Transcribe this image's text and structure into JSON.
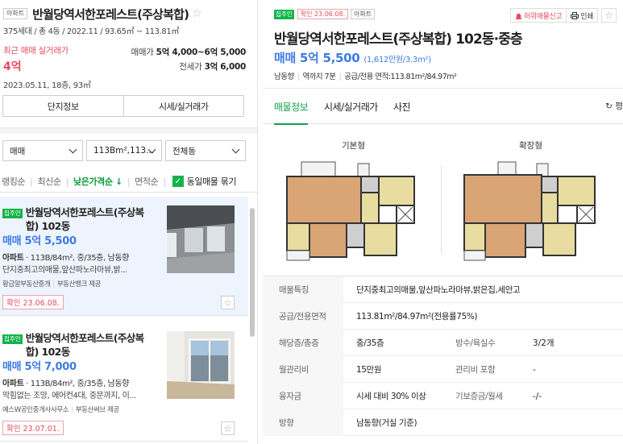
{
  "left": {
    "header": {
      "type_tag": "아파트",
      "title": "반월당역서한포레스트(주상복합)",
      "subtitle": "375세대 / 총 4동 / 2022.11 / 93.65㎡ ~ 113.81㎡",
      "recent_label": "최근 매매 실거래가",
      "recent_value": "4억",
      "recent_date": "2023.05.11, 18층, 93㎡",
      "sale_label": "매매가",
      "sale_range": "5억 4,000~6억 5,000",
      "rent_label": "전세가",
      "rent_range": "3억 6,000"
    },
    "buttons": {
      "complex_info": "단지정보",
      "market_price": "시세/실거래가"
    },
    "filters": {
      "trade_type": "매매",
      "area": "113Bm²,113...",
      "building": "전체동"
    },
    "sort": {
      "options": [
        "랭킹순",
        "최신순",
        "낮은가격순 ↓",
        "면적순"
      ],
      "active_index": 2,
      "group_label": "동일매물 묶기",
      "group_checked": true
    },
    "listings": [
      {
        "owner_badge": "집주인",
        "title": "반월당역서한포레스트(주상복합) 102동",
        "price": "매매 5억 5,500",
        "spec_type": "아파트",
        "spec": " · 113B/84m², 중/35층, 남동향",
        "desc": "단지중최고의매물,앞산파노라마뷰,밝...",
        "agent": "황금알부동산중개",
        "provider": "부동산뱅크 제공",
        "confirm": "확인 23.06.08.",
        "selected": true
      },
      {
        "owner_badge": "집주인",
        "title": "반월당역서한포레스트(주상복합) 102동",
        "price": "매매 5억 7,000",
        "spec_type": "아파트",
        "spec": " · 113B/84m², 중/35층, 남동향",
        "desc": "막힘없는 조망, 에어컨4대, 중문까지, 이...",
        "agent": "예스W공인중개사사무소",
        "provider": "부동산써브 제공",
        "confirm": "확인 23.07.01.",
        "selected": false
      }
    ]
  },
  "right": {
    "owner_badge": "집주인",
    "confirm_tag": "확인 23.06.08.",
    "type_tag": "아파트",
    "report_label": "허위매물신고",
    "print_label": "인쇄",
    "title": "반월당역서한포레스트(주상복합) 102동·중층",
    "price": "매매 5억 5,500",
    "price_per": "(1,612만원/3.3m²)",
    "info": [
      "남동향",
      "역까지 7분",
      "공급/전용 면적:113.81m²/84.97m²"
    ],
    "tabs": [
      "매물정보",
      "시세/실거래가",
      "사진"
    ],
    "active_tab": 0,
    "tab_extra": "평",
    "plans": {
      "basic_label": "기본형",
      "extended_label": "확장형"
    },
    "specs": [
      {
        "k": "매물특징",
        "v": "단지중최고의매물,앞산파노라마뷰,밝은집,세안고"
      },
      {
        "k": "공급/전용면적",
        "v": "113.81m²/84.97m²(전용률75%)"
      },
      {
        "k": "해당층/총층",
        "v": "중/35층",
        "k2": "방수/욕실수",
        "v2": "3/2개"
      },
      {
        "k": "월관리비",
        "v": "15만원",
        "k2": "관리비 포함",
        "v2": "-"
      },
      {
        "k": "융자금",
        "v": "시세 대비 30% 이상",
        "k2": "기보증금/월세",
        "v2": "-/-"
      },
      {
        "k": "방향",
        "v": "남동향(거실 기준)"
      }
    ]
  },
  "colors": {
    "accent_green": "#12a049",
    "price_blue": "#3d7be4",
    "alert_red": "#e84a5f",
    "selected_bg": "#eef4fd"
  }
}
